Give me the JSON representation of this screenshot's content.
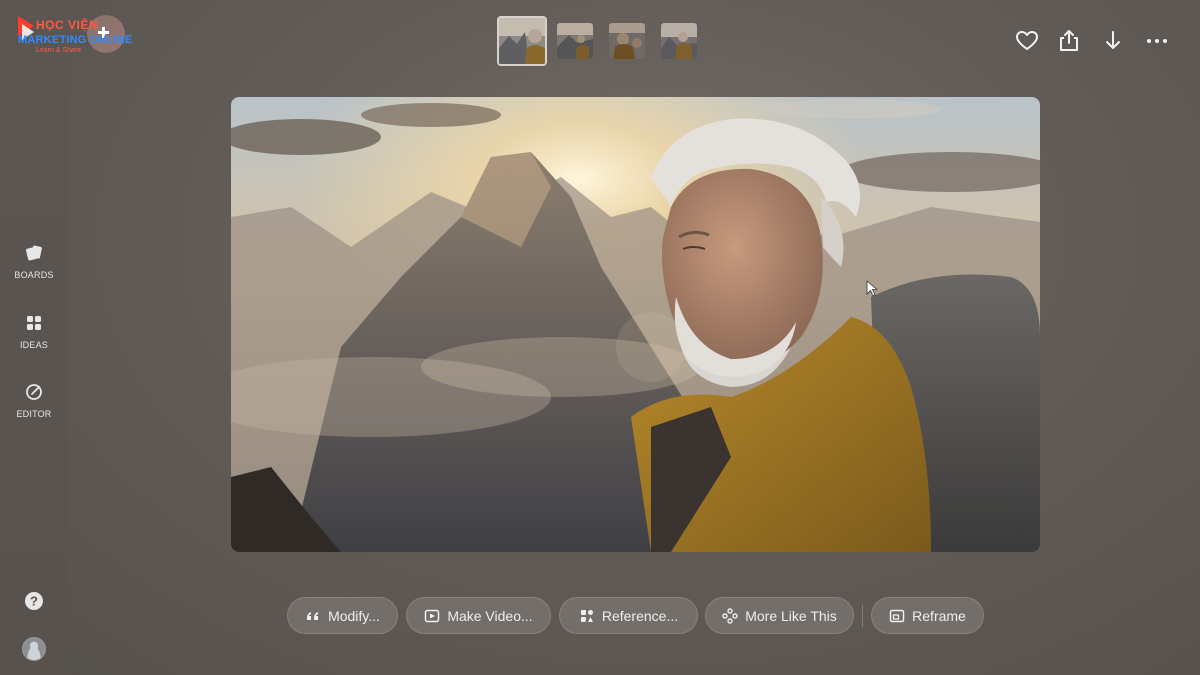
{
  "logo": {
    "line1": "HỌC VIỆN",
    "line2": "MARKETING ONLINE",
    "line3": "Learn & Share"
  },
  "sidebar": {
    "items": [
      {
        "label": "BOARDS",
        "icon": "boards-icon"
      },
      {
        "label": "IDEAS",
        "icon": "ideas-icon"
      },
      {
        "label": "EDITOR",
        "icon": "editor-icon"
      }
    ],
    "help_icon": "help-icon",
    "avatar_icon": "user-avatar"
  },
  "thumbnails": [
    {
      "icon": "thumbnail-1",
      "selected": true
    },
    {
      "icon": "thumbnail-2",
      "selected": false
    },
    {
      "icon": "thumbnail-3",
      "selected": false
    },
    {
      "icon": "thumbnail-4",
      "selected": false
    }
  ],
  "top_actions": [
    {
      "icon": "heart-icon"
    },
    {
      "icon": "share-icon"
    },
    {
      "icon": "download-icon"
    },
    {
      "icon": "more-icon"
    }
  ],
  "toolbar": {
    "modify": "Modify...",
    "make_video": "Make Video...",
    "reference": "Reference...",
    "more_like_this": "More Like This",
    "reframe": "Reframe"
  },
  "colors": {
    "background": "#625c58",
    "sidebar": "#5a5551",
    "button_bg": "#7a7470",
    "text": "#ececec"
  }
}
